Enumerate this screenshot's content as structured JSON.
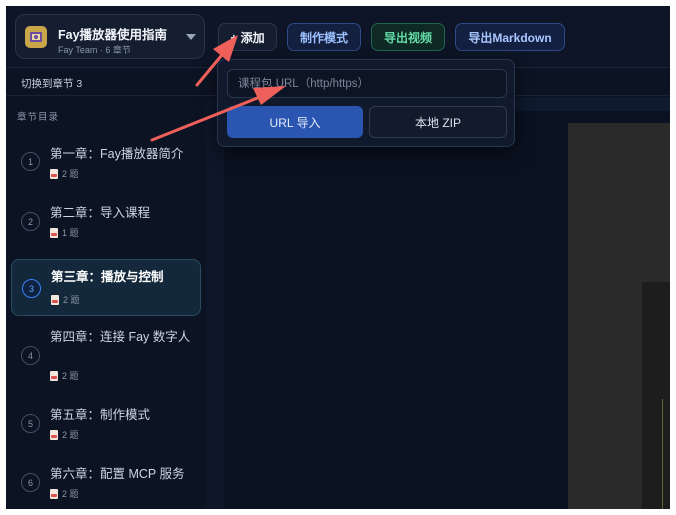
{
  "course": {
    "title": "Fay播放器使用指南",
    "subtitle": "Fay Team · 6 章节",
    "logo_icon": "film-icon",
    "dropdown_icon": "caret-down-icon"
  },
  "toolbar": {
    "add_label": "+ 添加",
    "make_mode_label": "制作模式",
    "export_video_label": "导出视频",
    "export_markdown_label": "导出Markdown"
  },
  "subbar": {
    "text": "切换到章节 3"
  },
  "sidebar": {
    "title": "章节目录",
    "chapters": [
      {
        "num": "1",
        "title": "第一章：Fay播放器简介",
        "meta": "2 题",
        "active": false
      },
      {
        "num": "2",
        "title": "第二章：导入课程",
        "meta": "1 题",
        "active": false
      },
      {
        "num": "3",
        "title": "第三章：播放与控制",
        "meta": "2 题",
        "active": true
      },
      {
        "num": "4",
        "title": "第四章：连接 Fay 数字人",
        "meta": "2 题",
        "active": false
      },
      {
        "num": "5",
        "title": "第五章：制作模式",
        "meta": "2 题",
        "active": false
      },
      {
        "num": "6",
        "title": "第六章：配置 MCP 服务",
        "meta": "2 题",
        "active": false
      }
    ]
  },
  "popover": {
    "url_placeholder": "课程包 URL（http/https）",
    "url_value": "",
    "url_import_label": "URL 导入",
    "zip_label": "本地 ZIP"
  },
  "colors": {
    "background": "#0b1220",
    "accent_blue": "#2a55b0",
    "export_video_green": "#64dba7",
    "annotation_arrow": "#f0605a"
  }
}
